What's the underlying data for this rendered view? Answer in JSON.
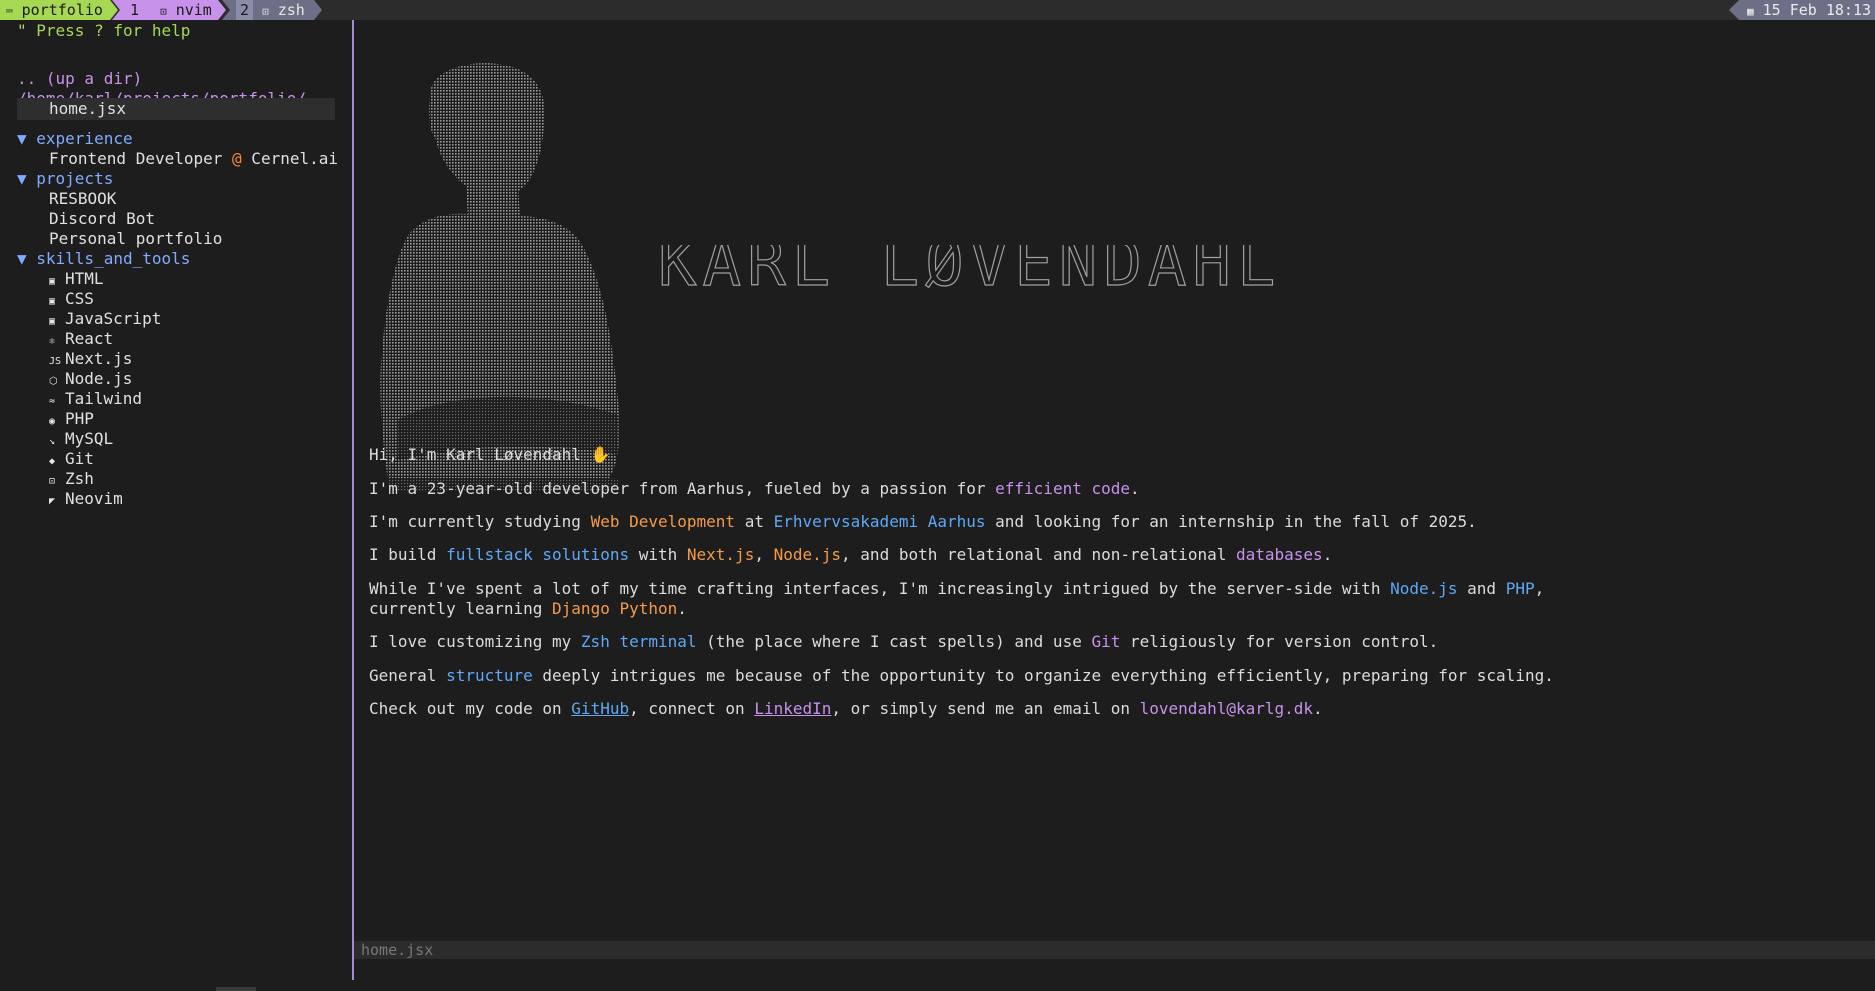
{
  "tmux": {
    "session": "portfolio",
    "windows": [
      {
        "num": "1",
        "label": "nvim"
      },
      {
        "num": "2",
        "label": "zsh"
      }
    ],
    "date": "15 Feb 18:13"
  },
  "tree": {
    "help": "\" Press ? for help",
    "updir": ".. (up a dir)",
    "path": "/home/karl/projects/portfolio/",
    "selected_file": "home.jsx",
    "experience": {
      "label": "▼ experience",
      "item_prefix": "Frontend Developer ",
      "item_at": "@",
      "item_suffix": " Cernel.ai"
    },
    "projects": {
      "label": "▼ projects",
      "items": [
        "RESBOOK",
        "Discord Bot",
        "Personal portfolio"
      ]
    },
    "skills": {
      "label": "▼ skills_and_tools",
      "items": [
        {
          "label": "HTML",
          "icon": "html-icon"
        },
        {
          "label": "CSS",
          "icon": "css-icon"
        },
        {
          "label": "JavaScript",
          "icon": "javascript-icon"
        },
        {
          "label": "React",
          "icon": "react-icon"
        },
        {
          "label": "Next.js",
          "icon": "nextjs-icon"
        },
        {
          "label": "Node.js",
          "icon": "nodejs-icon"
        },
        {
          "label": "Tailwind",
          "icon": "tailwind-icon"
        },
        {
          "label": "PHP",
          "icon": "php-icon"
        },
        {
          "label": "MySQL",
          "icon": "mysql-icon"
        },
        {
          "label": "Git",
          "icon": "git-icon"
        },
        {
          "label": "Zsh",
          "icon": "terminal-icon"
        },
        {
          "label": "Neovim",
          "icon": "neovim-icon"
        }
      ]
    }
  },
  "editor": {
    "ascii_name": "KARL LØVENDAHL",
    "greeting": "Hi, I'm Karl Løvendahl",
    "p1": {
      "a": "I'm a 23-year-old developer from Aarhus, fueled by a passion for ",
      "b": "efficient code",
      "c": "."
    },
    "p2": {
      "a": "I'm currently studying ",
      "b": "Web Development",
      "c": " at ",
      "d": "Erhvervsakademi Aarhus",
      "e": " and looking for an internship in the fall of 2025."
    },
    "p3": {
      "a": "I build ",
      "b": "fullstack solutions",
      "c": " with ",
      "d": "Next.js",
      "e": ", ",
      "f": "Node.js",
      "g": ", and both relational and non-relational ",
      "h": "databases",
      "i": "."
    },
    "p4": {
      "a": "While I've spent a lot of my time crafting interfaces, I'm increasingly intrigued by the server-side with ",
      "b": "Node.js",
      "c": " and ",
      "d": "PHP",
      "e": ",",
      "f": "currently learning ",
      "g": "Django Python",
      "h": "."
    },
    "p5": {
      "a": "I love customizing my ",
      "b": "Zsh terminal",
      "c": " (the place where I cast spells) and use ",
      "d": "Git",
      "e": " religiously for version control."
    },
    "p6": {
      "a": "General ",
      "b": "structure",
      "c": " deeply intrigues me because of the opportunity to organize everything efficiently, preparing for scaling."
    },
    "p7": {
      "a": "Check out my code on ",
      "b": "GitHub",
      "c": ", connect on ",
      "d": "LinkedIn",
      "e": ", or simply send me an email on ",
      "f": "lovendahl@karlg.dk",
      "g": "."
    },
    "statusline": "home.jsx"
  }
}
